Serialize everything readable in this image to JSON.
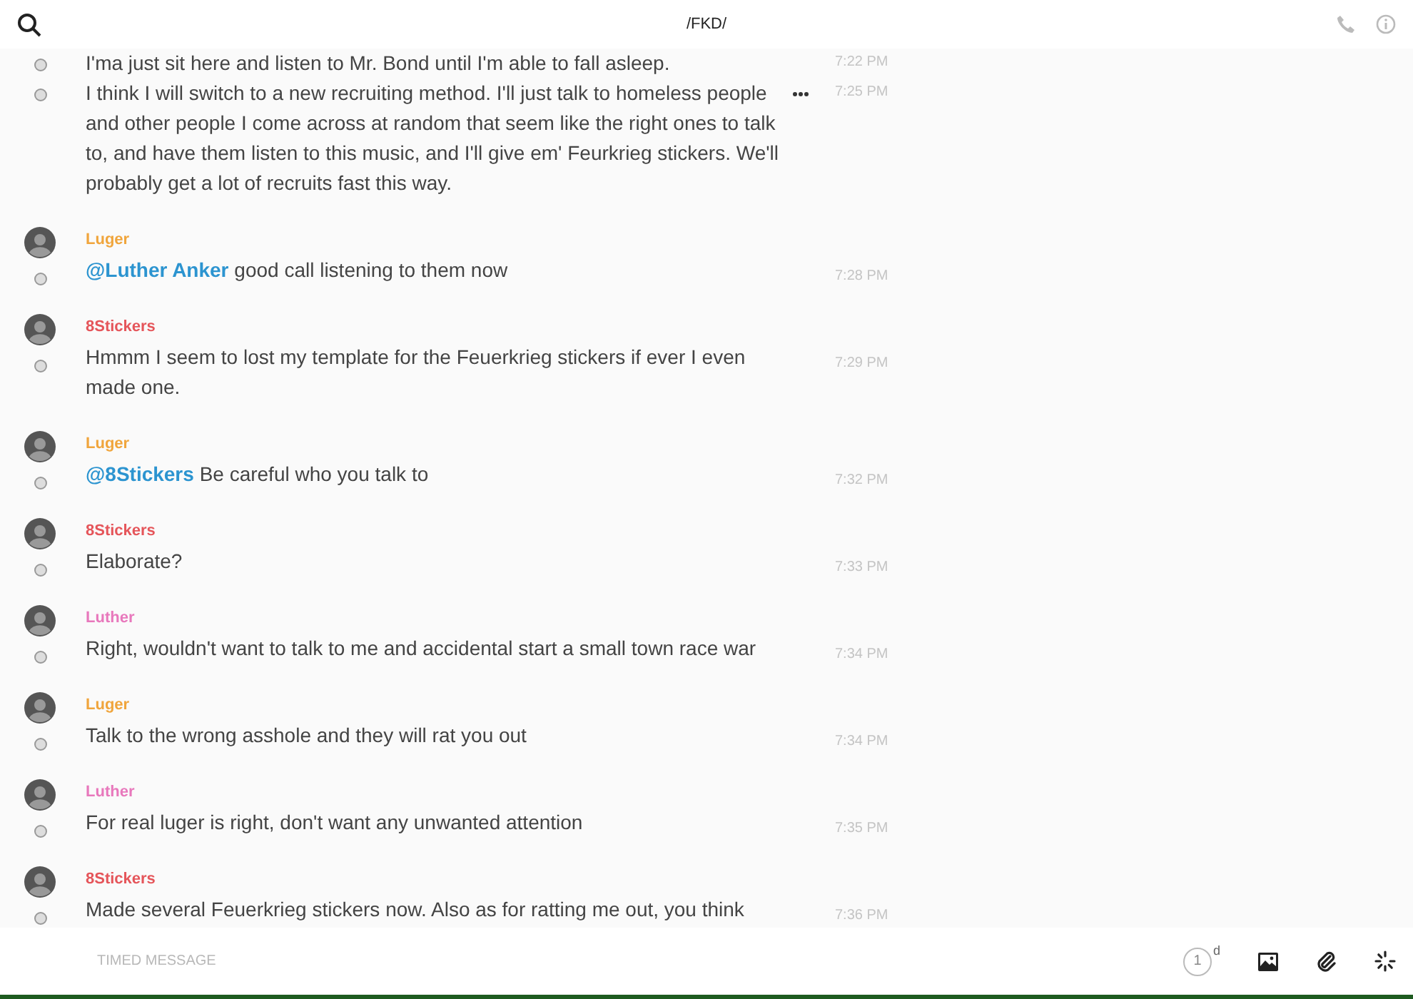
{
  "header": {
    "title": "/FKD/"
  },
  "messages": [
    {
      "text": "I'ma just sit here and listen to Mr. Bond until I'm able to fall asleep.",
      "time": "7:22 PM",
      "hovered": false
    },
    {
      "text": "I think I will switch to a new recruiting method. I'll just talk to homeless people and other people I come across at random that seem like the right ones to talk to, and have them listen to this music, and I'll give em' Feurkrieg stickers. We'll probably get a lot of recruits fast this way.",
      "time": "7:25 PM",
      "hovered": true
    },
    {
      "author": "Luger",
      "color": "#f0a53c",
      "mention": "@Luther Anker",
      "text": "good call listening to them now",
      "time": "7:28 PM",
      "hovered": false
    },
    {
      "author": "8Stickers",
      "color": "#e5555a",
      "text": "Hmmm I seem to lost my template for the Feuerkrieg stickers if ever I even made one.",
      "time": "7:29 PM",
      "hovered": false
    },
    {
      "author": "Luger",
      "color": "#f0a53c",
      "mention": "@8Stickers",
      "text": "Be careful who you talk to",
      "time": "7:32 PM",
      "hovered": false
    },
    {
      "author": "8Stickers",
      "color": "#e5555a",
      "text": "Elaborate?",
      "time": "7:33 PM",
      "hovered": false
    },
    {
      "author": "Luther",
      "color": "#e878bc",
      "text": "Right, wouldn't want to talk to me and accidental start a small town race war",
      "time": "7:34 PM",
      "hovered": false
    },
    {
      "author": "Luger",
      "color": "#f0a53c",
      "text": "Talk to the wrong asshole and they will rat you out",
      "time": "7:34 PM",
      "hovered": false
    },
    {
      "author": "Luther",
      "color": "#e878bc",
      "text": "For real luger is right, don't want any unwanted attention",
      "time": "7:35 PM",
      "hovered": false
    },
    {
      "author": "8Stickers",
      "color": "#e5555a",
      "text": "Made several Feuerkrieg stickers now. Also as for ratting me out, you think",
      "time": "7:36 PM",
      "hovered": false
    }
  ],
  "composer": {
    "placeholder": "TIMED MESSAGE",
    "timer_value": "1",
    "timer_unit": "d"
  }
}
